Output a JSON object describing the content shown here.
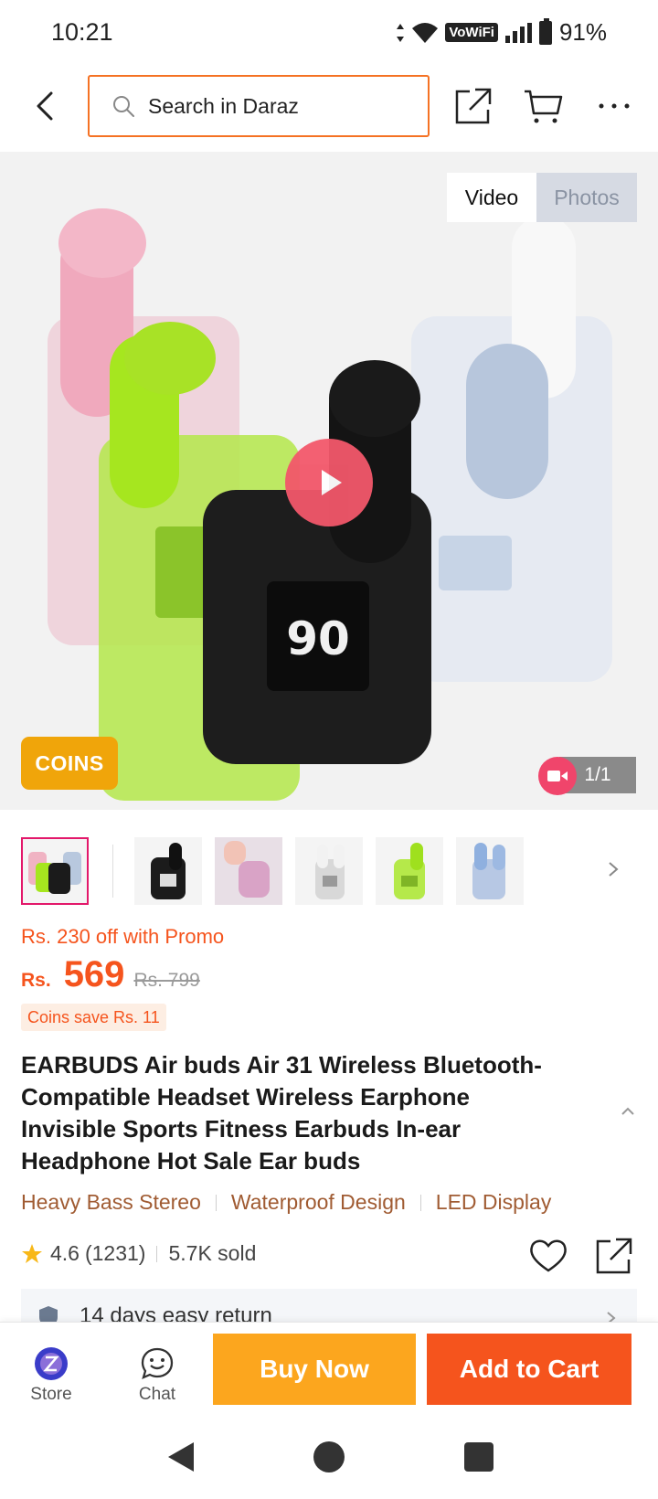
{
  "status_bar": {
    "time": "10:21",
    "network": "VoWiFi",
    "battery": "91%"
  },
  "header": {
    "search_placeholder": "Search in Daraz"
  },
  "gallery": {
    "tabs": [
      {
        "label": "Video"
      },
      {
        "label": "Photos"
      }
    ],
    "coins_badge": "COINS",
    "counter": "1/1",
    "case_display": "90"
  },
  "price": {
    "promo": "Rs. 230 off with Promo",
    "currency": "Rs.",
    "current": "569",
    "original": "Rs. 799",
    "coins_save": "Coins save Rs. 11"
  },
  "product": {
    "title": "EARBUDS Air buds Air 31 Wireless Bluetooth-Compatible Headset Wireless Earphone Invisible Sports Fitness Earbuds In-ear Headphone Hot Sale Ear buds",
    "features": [
      "Heavy Bass Stereo",
      "Waterproof Design",
      "LED Display"
    ],
    "rating": "4.6",
    "rating_count": "(1231)",
    "sold": "5.7K sold"
  },
  "return_policy": "14 days easy return",
  "actions": {
    "store": "Store",
    "chat": "Chat",
    "buy_now": "Buy Now",
    "add_to_cart": "Add to Cart"
  },
  "colors": {
    "accent": "#f5541d",
    "buy_now": "#fca61e",
    "coins": "#f0a50a",
    "feature_text": "#a05b32"
  }
}
